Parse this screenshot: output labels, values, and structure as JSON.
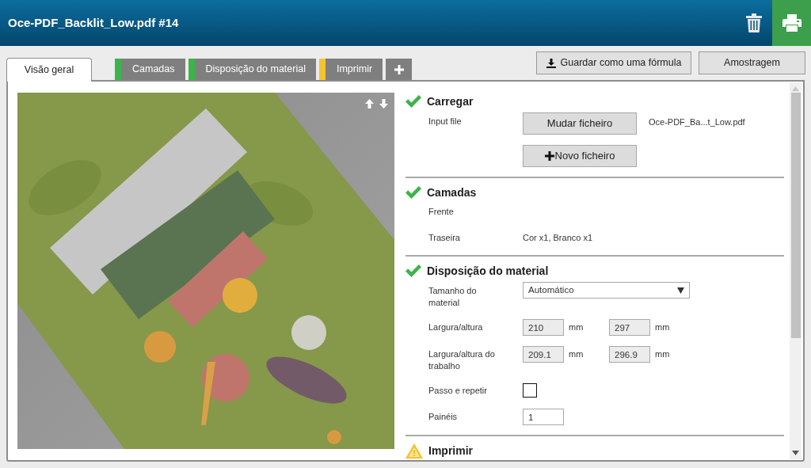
{
  "window": {
    "title": "Oce-PDF_Backlit_Low.pdf #14"
  },
  "tabs": [
    {
      "label": "Visão geral",
      "selected": true
    },
    {
      "label": "Camadas",
      "selected": false,
      "color": "#3cb44b"
    },
    {
      "label": "Disposição do material",
      "selected": false,
      "color": "#3cb44b"
    },
    {
      "label": "Imprimir",
      "selected": false,
      "color": "#f4c430"
    }
  ],
  "toolbar": {
    "buttons": [
      {
        "label": "Guardar como uma fórmula",
        "kind": "download"
      },
      {
        "label": "Amostragem",
        "kind": "plain"
      }
    ]
  },
  "sections": [
    {
      "title": "Carregar",
      "complete": true,
      "rows": [
        {
          "kind": "file",
          "label": "Input file",
          "button": "Mudar ficheiro",
          "value": "Oce-PDF_Ba...t_Low.pdf"
        },
        {
          "kind": "add_button",
          "button": "Novo ficheiro"
        }
      ]
    },
    {
      "title": "Camadas",
      "complete": true,
      "rows": [
        {
          "kind": "text",
          "label": "Frente"
        },
        {
          "kind": "text",
          "label": "Traseira",
          "value": "Cor x1, Branco x1"
        }
      ]
    },
    {
      "title": "Disposição do material",
      "complete": true,
      "rows": [
        {
          "kind": "select",
          "label": "Tamanho do material",
          "value": "Automático"
        },
        {
          "kind": "dimensions",
          "label": "Largura/altura",
          "fields": [
            {
              "value": "210",
              "unit": "mm",
              "disabled": true
            },
            {
              "value": "297",
              "unit": "mm",
              "disabled": true
            }
          ]
        },
        {
          "kind": "dimensions",
          "label": "Largura/altura do trabalho",
          "fields": [
            {
              "value": "209.1",
              "unit": "mm",
              "disabled": true
            },
            {
              "value": "296.9",
              "unit": "mm",
              "disabled": true
            }
          ]
        },
        {
          "kind": "checkbox",
          "label": "Passo e repetir",
          "checked": false
        },
        {
          "kind": "input",
          "label": "Painéis",
          "value": "1",
          "disabled": false
        }
      ]
    },
    {
      "title": "Imprimir",
      "complete": false
    }
  ]
}
